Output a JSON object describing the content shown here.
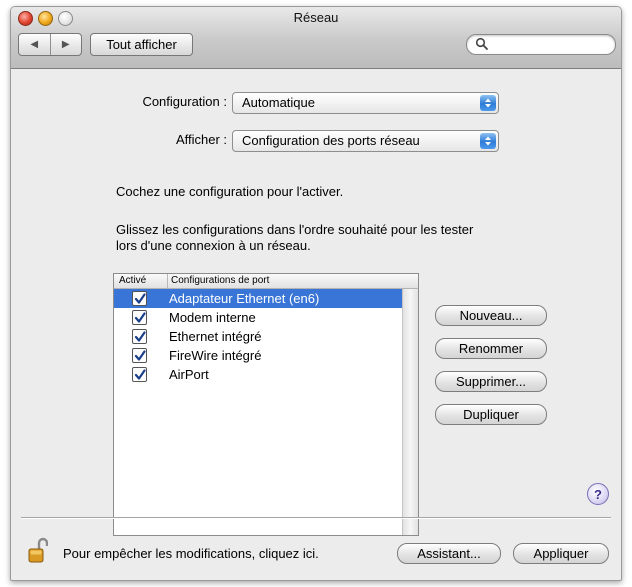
{
  "window": {
    "title": "Réseau"
  },
  "toolbar": {
    "show_all": "Tout afficher",
    "search_placeholder": "",
    "search_value": ""
  },
  "form": {
    "configuration_label": "Configuration :",
    "configuration_value": "Automatique",
    "show_label": "Afficher :",
    "show_value": "Configuration des ports réseau"
  },
  "instructions": {
    "line1": "Cochez une configuration pour l'activer.",
    "line2a": "Glissez les configurations dans l'ordre souhaité pour les tester",
    "line2b": "lors d'une connexion à un réseau."
  },
  "ports_table": {
    "columns": [
      "Activé",
      "Configurations de port"
    ],
    "rows": [
      {
        "name": "Adaptateur Ethernet (en6)",
        "checked": true,
        "selected": true
      },
      {
        "name": "Modem interne",
        "checked": true,
        "selected": false
      },
      {
        "name": "Ethernet intégré",
        "checked": true,
        "selected": false
      },
      {
        "name": "FireWire intégré",
        "checked": true,
        "selected": false
      },
      {
        "name": "AirPort",
        "checked": true,
        "selected": false
      }
    ]
  },
  "side_buttons": {
    "new": "Nouveau...",
    "rename": "Renommer",
    "delete": "Supprimer...",
    "duplicate": "Dupliquer"
  },
  "help": {
    "glyph": "?"
  },
  "footer": {
    "lock_text": "Pour empêcher les modifications, cliquez ici.",
    "assistant": "Assistant...",
    "apply": "Appliquer"
  },
  "colors": {
    "selection": "#3875d7",
    "popup_arrows": "#2f7bd6"
  }
}
